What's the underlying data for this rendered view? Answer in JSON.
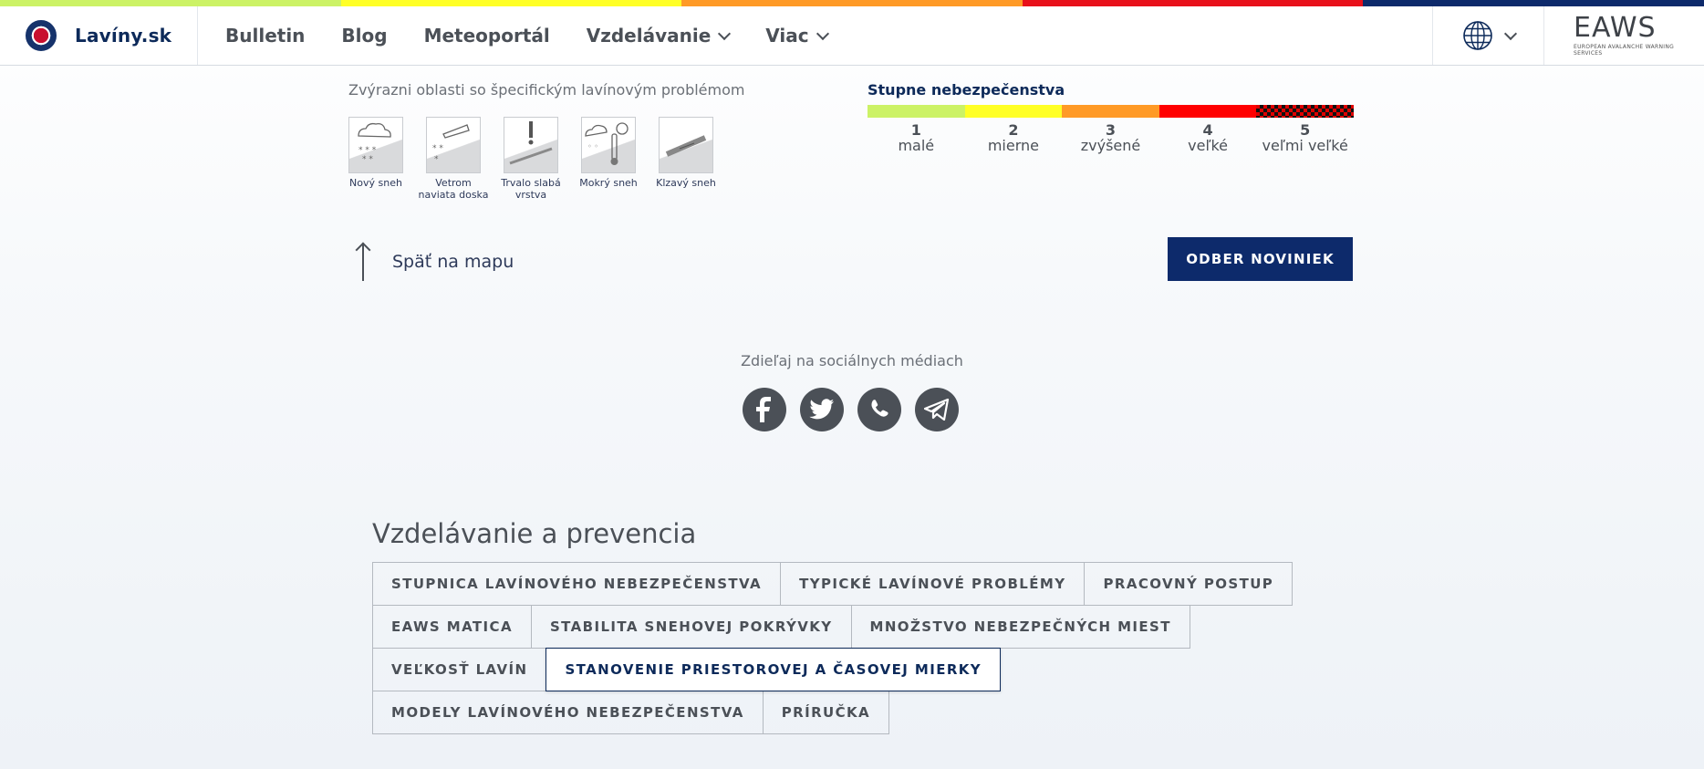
{
  "strip_colors": [
    "#ccf266",
    "#ffff26",
    "#ff9a26",
    "#e8101a",
    "#0d2a6b"
  ],
  "header": {
    "brand": "Lavíny.sk",
    "nav": [
      {
        "label": "Bulletin",
        "dropdown": false
      },
      {
        "label": "Blog",
        "dropdown": false
      },
      {
        "label": "Meteoportál",
        "dropdown": false
      },
      {
        "label": "Vzdelávanie",
        "dropdown": true
      },
      {
        "label": "Viac",
        "dropdown": true
      }
    ],
    "language_icon": "globe-icon",
    "partner_logo": "EAWS",
    "partner_sub": "EUROPEAN AVALANCHE WARNING SERVICES"
  },
  "problems": {
    "title": "Zvýrazni oblasti so špecifickým lavínovým problémom",
    "items": [
      {
        "label": "Nový sneh",
        "icon": "new-snow-icon"
      },
      {
        "label": "Vetrom naviata doska",
        "icon": "wind-slab-icon"
      },
      {
        "label": "Trvalo slabá vrstva",
        "icon": "persistent-weak-layer-icon"
      },
      {
        "label": "Mokrý sneh",
        "icon": "wet-snow-icon"
      },
      {
        "label": "Klzavý sneh",
        "icon": "gliding-snow-icon"
      }
    ]
  },
  "danger_scale": {
    "title": "Stupne nebezpečenstva",
    "levels": [
      {
        "num": "1",
        "name": "malé",
        "color": "#ccf266"
      },
      {
        "num": "2",
        "name": "mierne",
        "color": "#ffff26"
      },
      {
        "num": "3",
        "name": "zvýšené",
        "color": "#ff9a26"
      },
      {
        "num": "4",
        "name": "veľké",
        "color": "#ff0000"
      },
      {
        "num": "5",
        "name": "veľmi veľké",
        "color": "checkered"
      }
    ]
  },
  "back_label": "Späť na mapu",
  "subscribe_label": "ODBER NOVINIEK",
  "share": {
    "title": "Zdieľaj na sociálnych médiach",
    "networks": [
      "facebook",
      "twitter",
      "whatsapp",
      "telegram"
    ]
  },
  "education": {
    "title": "Vzdelávanie a prevencia",
    "rows": [
      [
        "STUPNICA LAVÍNOVÉHO NEBEZPEČENSTVA",
        "TYPICKÉ LAVÍNOVÉ PROBLÉMY",
        "PRACOVNÝ POSTUP"
      ],
      [
        "EAWS MATICA",
        "STABILITA SNEHOVEJ POKRÝVKY",
        "MNOŽSTVO NEBEZPEČNÝCH MIEST"
      ],
      [
        "VEĽKOSŤ LAVÍN",
        "STANOVENIE PRIESTOROVEJ A ČASOVEJ MIERKY"
      ],
      [
        "MODELY LAVÍNOVÉHO NEBEZPEČENSTVA",
        "PRÍRUČKA"
      ]
    ],
    "active": "STANOVENIE PRIESTOROVEJ A ČASOVEJ MIERKY"
  }
}
